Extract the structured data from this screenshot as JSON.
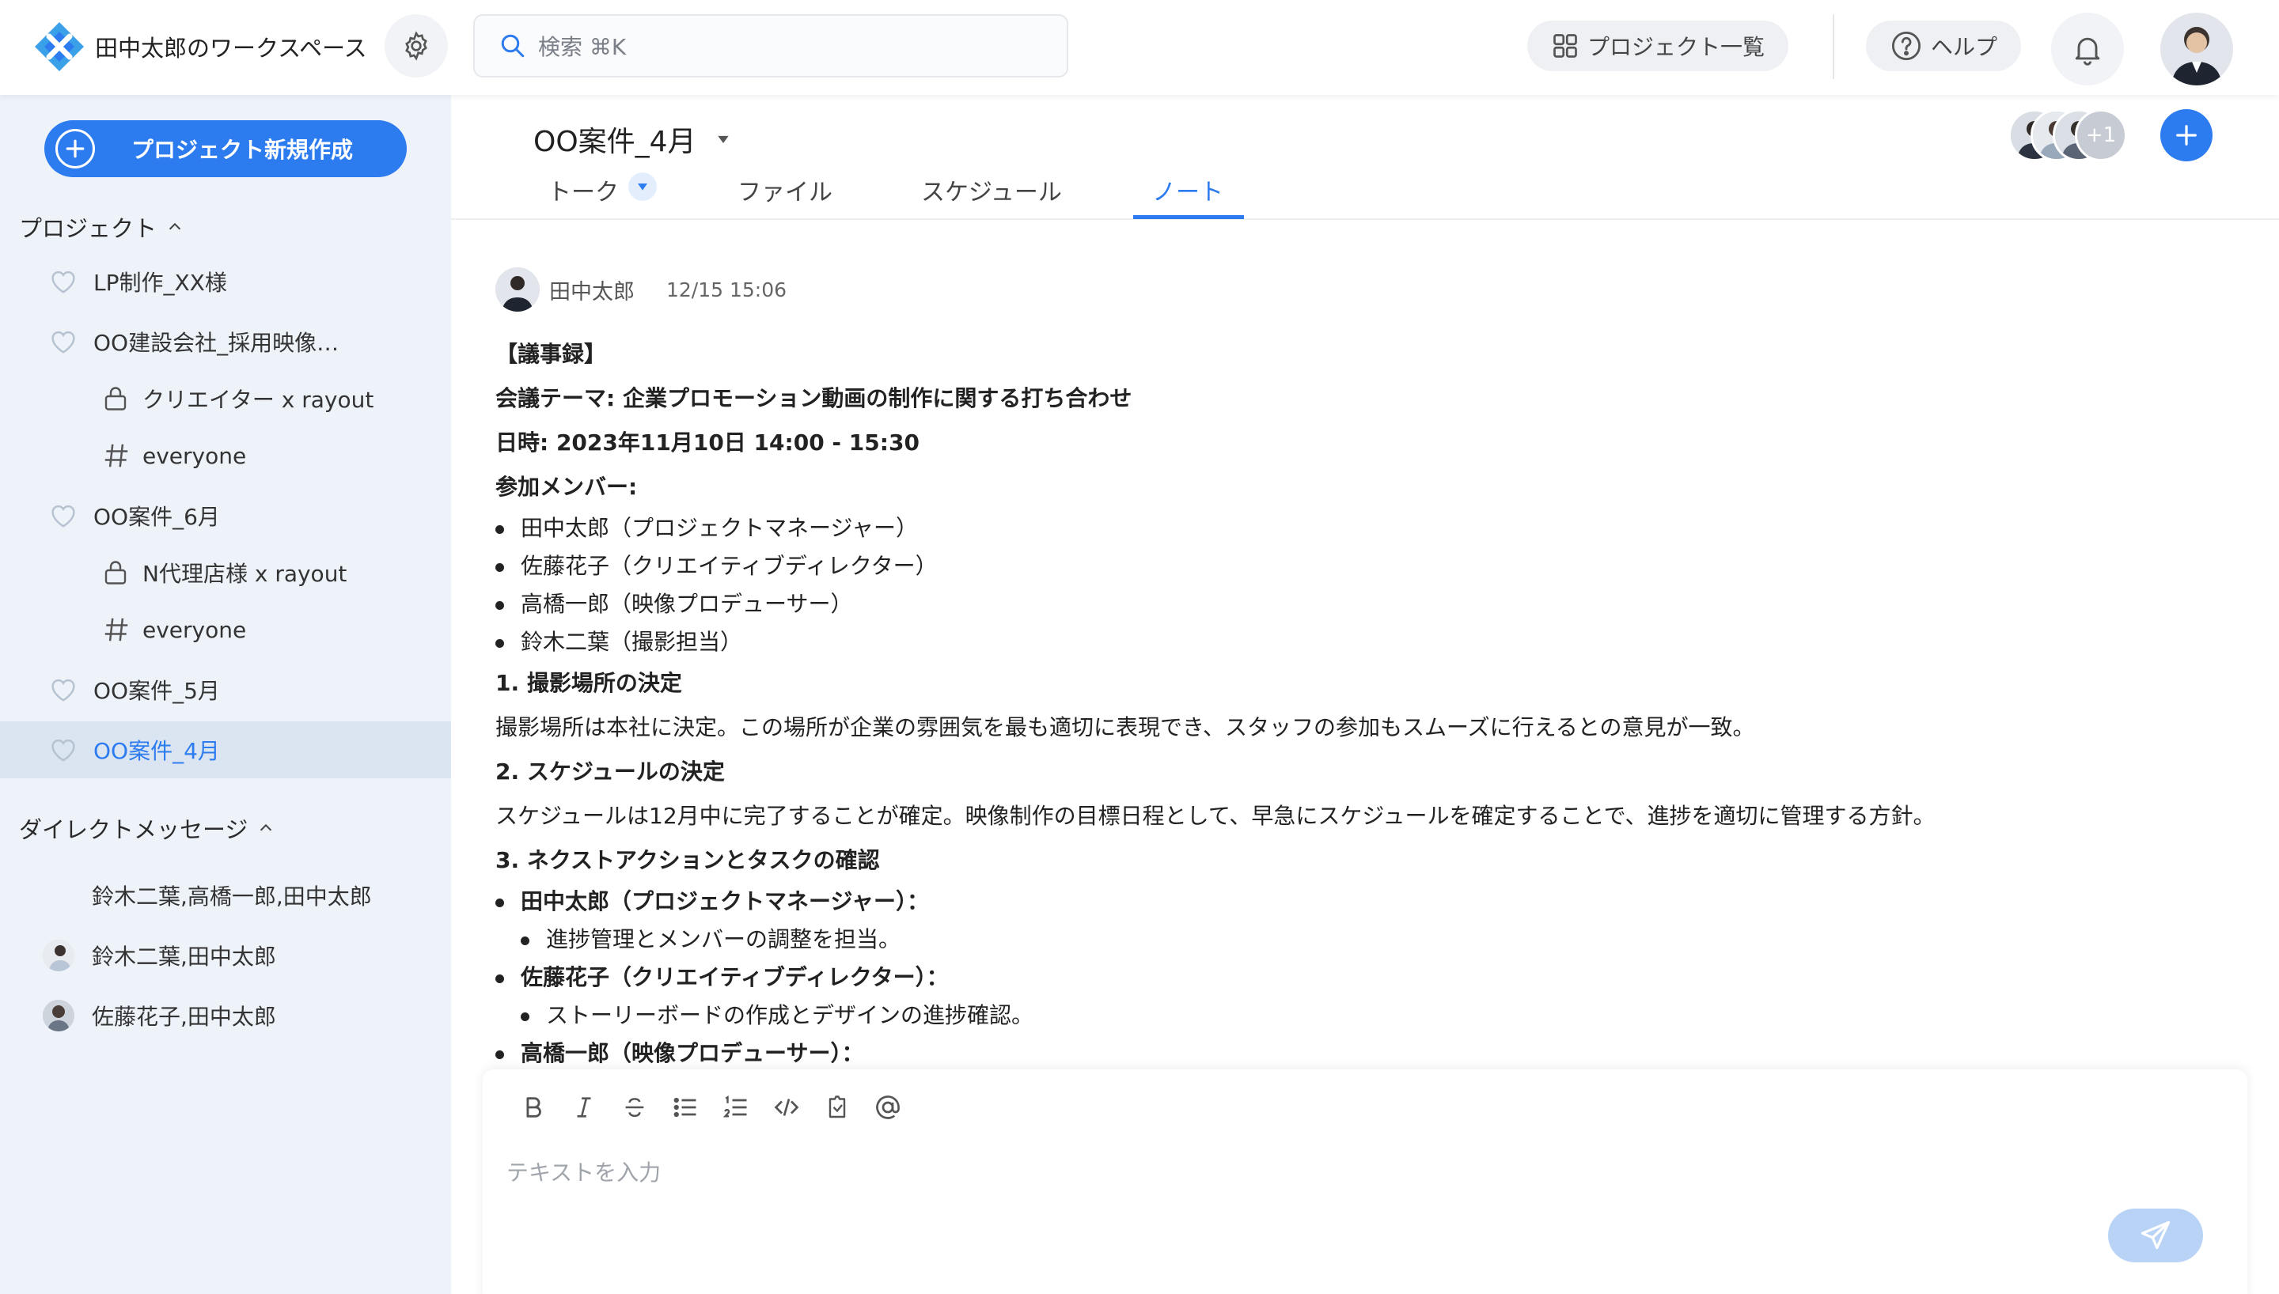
{
  "header": {
    "workspace_name": "田中太郎のワークスペース",
    "search_placeholder": "検索 ⌘K",
    "projects_button": "プロジェクト一覧",
    "help_button": "ヘルプ",
    "icons": [
      "logo-icon",
      "gear-icon",
      "search-icon",
      "grid-icon",
      "help-icon",
      "bell-icon"
    ]
  },
  "sidebar": {
    "new_project": "プロジェクト新規作成",
    "projects_title": "プロジェクト",
    "items": [
      {
        "label": "LP制作_XX様",
        "icon": "heart-icon"
      },
      {
        "label": "OO建設会社_採用映像…",
        "icon": "heart-icon"
      },
      {
        "label": "クリエイター x rayout",
        "icon": "lock-icon"
      },
      {
        "label": "everyone",
        "icon": "hash-icon"
      },
      {
        "label": "OO案件_6月",
        "icon": "heart-icon"
      },
      {
        "label": "N代理店様 x rayout",
        "icon": "lock-icon"
      },
      {
        "label": "everyone",
        "icon": "hash-icon"
      },
      {
        "label": "OO案件_5月",
        "icon": "heart-icon"
      },
      {
        "label": "OO案件_4月",
        "icon": "heart-icon",
        "active": true
      }
    ],
    "dm_title": "ダイレクトメッセージ",
    "dms": [
      {
        "label": "鈴木二葉,高橋一郎,田中太郎"
      },
      {
        "label": "鈴木二葉,田中太郎"
      },
      {
        "label": "佐藤花子,田中太郎"
      }
    ]
  },
  "main": {
    "channel_title": "OO案件_4月",
    "tabs": [
      "トーク",
      "ファイル",
      "スケジュール",
      "ノート"
    ],
    "active_tab": "ノート",
    "member_more": "+1",
    "accent_color": "#2c7bef"
  },
  "note": {
    "author": "田中太郎",
    "time": "12/15 15:06",
    "lines": {
      "l1": "【議事録】",
      "l2": "会議テーマ: 企業プロモーション動画の制作に関する打ち合わせ",
      "l3": "日時: 2023年11月10日 14:00 - 15:30",
      "l4": "参加メンバー:",
      "m1": "田中太郎（プロジェクトマネージャー）",
      "m2": "佐藤花子（クリエイティブディレクター）",
      "m3": "高橋一郎（映像プロデューサー）",
      "m4": "鈴木二葉（撮影担当）",
      "h1": "1. 撮影場所の決定",
      "p1": "撮影場所は本社に決定。この場所が企業の雰囲気を最も適切に表現でき、スタッフの参加もスムーズに行えるとの意見が一致。",
      "h2": "2. スケジュールの決定",
      "p2": "スケジュールは12月中に完了することが確定。映像制作の目標日程として、早急にスケジュールを確定することで、進捗を適切に管理する方針。",
      "h3": "3. ネクストアクションとタスクの確認",
      "t1": "田中太郎（プロジェクトマネージャー）：",
      "t1a": "進捗管理とメンバーの調整を担当。",
      "t2": "佐藤花子（クリエイティブディレクター）：",
      "t2a": "ストーリーボードの作成とデザインの進捗確認。",
      "t3": "高橋一郎（映像プロデューサー）："
    }
  },
  "composer": {
    "placeholder": "テキストを入力",
    "tools": [
      "bold-icon",
      "italic-icon",
      "strikethrough-icon",
      "bullet-list-icon",
      "numbered-list-icon",
      "code-icon",
      "clip-icon",
      "mention-icon"
    ]
  }
}
